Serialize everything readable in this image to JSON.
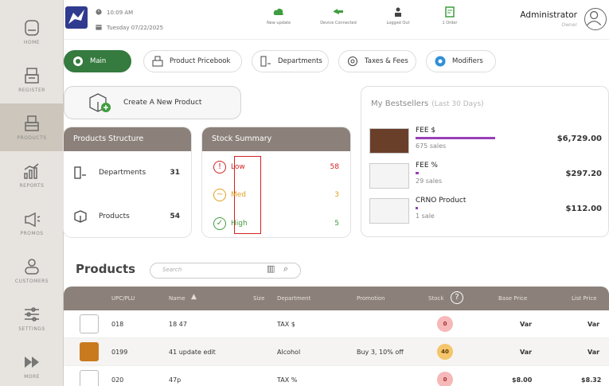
{
  "sidebar": {
    "items": [
      {
        "label": "HOME",
        "icon": "home-icon"
      },
      {
        "label": "REGISTER",
        "icon": "register-icon"
      },
      {
        "label": "PRODUCTS",
        "icon": "products-icon",
        "active": true
      },
      {
        "label": "REPORTS",
        "icon": "reports-icon"
      },
      {
        "label": "PROMOS",
        "icon": "promos-icon"
      },
      {
        "label": "CUSTOMERS",
        "icon": "customers-icon"
      },
      {
        "label": "SETTINGS",
        "icon": "settings-icon"
      },
      {
        "label": "MORE",
        "icon": "more-icon"
      }
    ]
  },
  "header": {
    "time": "10:09 AM",
    "date": "Tuesday 07/22/2025",
    "statuses": [
      "New update",
      "Device Connected",
      "Logged Out",
      "1 Order"
    ],
    "user_name": "Administrator",
    "user_role": "Owner"
  },
  "tabs": [
    "Main",
    "Product Pricebook",
    "Departments",
    "Taxes & Fees",
    "Modifiers"
  ],
  "create_label": "Create A New Product",
  "structure": {
    "title": "Products Structure",
    "rows": [
      {
        "label": "Departments",
        "value": "31"
      },
      {
        "label": "Products",
        "value": "54"
      }
    ]
  },
  "stock": {
    "title": "Stock Summary",
    "rows": [
      {
        "label": "Low",
        "value": "58"
      },
      {
        "label": "Med",
        "value": "3"
      },
      {
        "label": "High",
        "value": "5"
      }
    ]
  },
  "bestsellers": {
    "title": "My Bestsellers",
    "subtitle": "(Last 30 Days)",
    "items": [
      {
        "name": "FEE $",
        "sales": "675 sales",
        "price": "$6,729.00",
        "share": 1.0
      },
      {
        "name": "FEE %",
        "sales": "29 sales",
        "price": "$297.20",
        "share": 0.04
      },
      {
        "name": "CRNO Product",
        "sales": "1 sale",
        "price": "$112.00",
        "share": 0.01
      }
    ]
  },
  "products": {
    "title": "Products",
    "search_placeholder": "Search",
    "columns": [
      "UPC/PLU",
      "Name",
      "Size",
      "Department",
      "Promotion",
      "Stock",
      "Base Price",
      "List Price"
    ],
    "rows": [
      {
        "upc": "018",
        "name": "18 47",
        "size": "",
        "dept": "TAX $",
        "promo": "",
        "stock": "0",
        "base": "Var",
        "list": "Var"
      },
      {
        "upc": "0199",
        "name": "41 update edit",
        "size": "",
        "dept": "Alcohol",
        "promo": "Buy 3, 10% off",
        "stock": "40",
        "base": "Var",
        "list": "Var"
      },
      {
        "upc": "020",
        "name": "47p",
        "size": "",
        "dept": "TAX %",
        "promo": "",
        "stock": "0",
        "base": "$8.00",
        "list": "$8.32"
      }
    ]
  },
  "colors": {
    "accent": "#357a3e",
    "header_brown": "#8b817a",
    "bar_purple": "#9a3fb8",
    "highlight_red": "#d22222"
  }
}
